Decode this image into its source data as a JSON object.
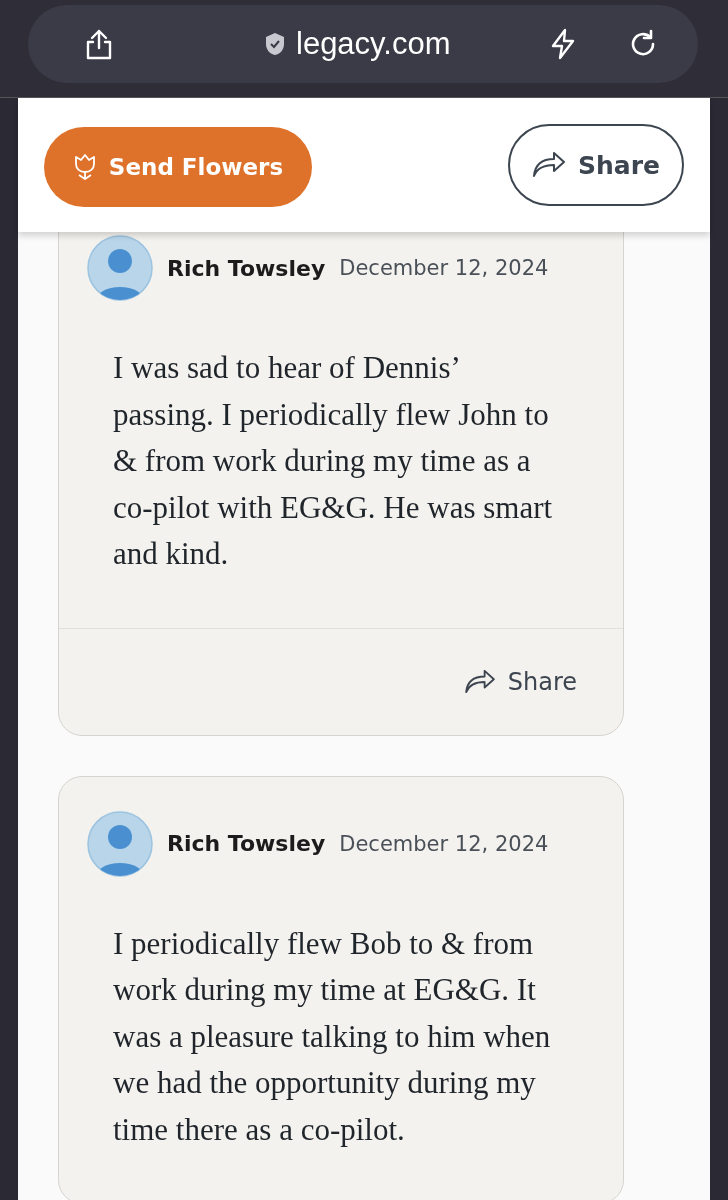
{
  "browser": {
    "url": "legacy.com"
  },
  "header": {
    "send_flowers": "Send Flowers",
    "share": "Share"
  },
  "posts": [
    {
      "author": "Rich Towsley",
      "date": "December 12, 2024",
      "text": "I was sad to hear of Dennis’ passing. I periodically flew John to & from work during my time as a co-pilot with EG&G. He was smart and kind.",
      "share": "Share"
    },
    {
      "author": "Rich Towsley",
      "date": "December 12, 2024",
      "text": "I periodically flew Bob to & from work during my time at EG&G. It was a pleasure talking to him when we had the opportunity during my time there as a co-pilot."
    }
  ]
}
